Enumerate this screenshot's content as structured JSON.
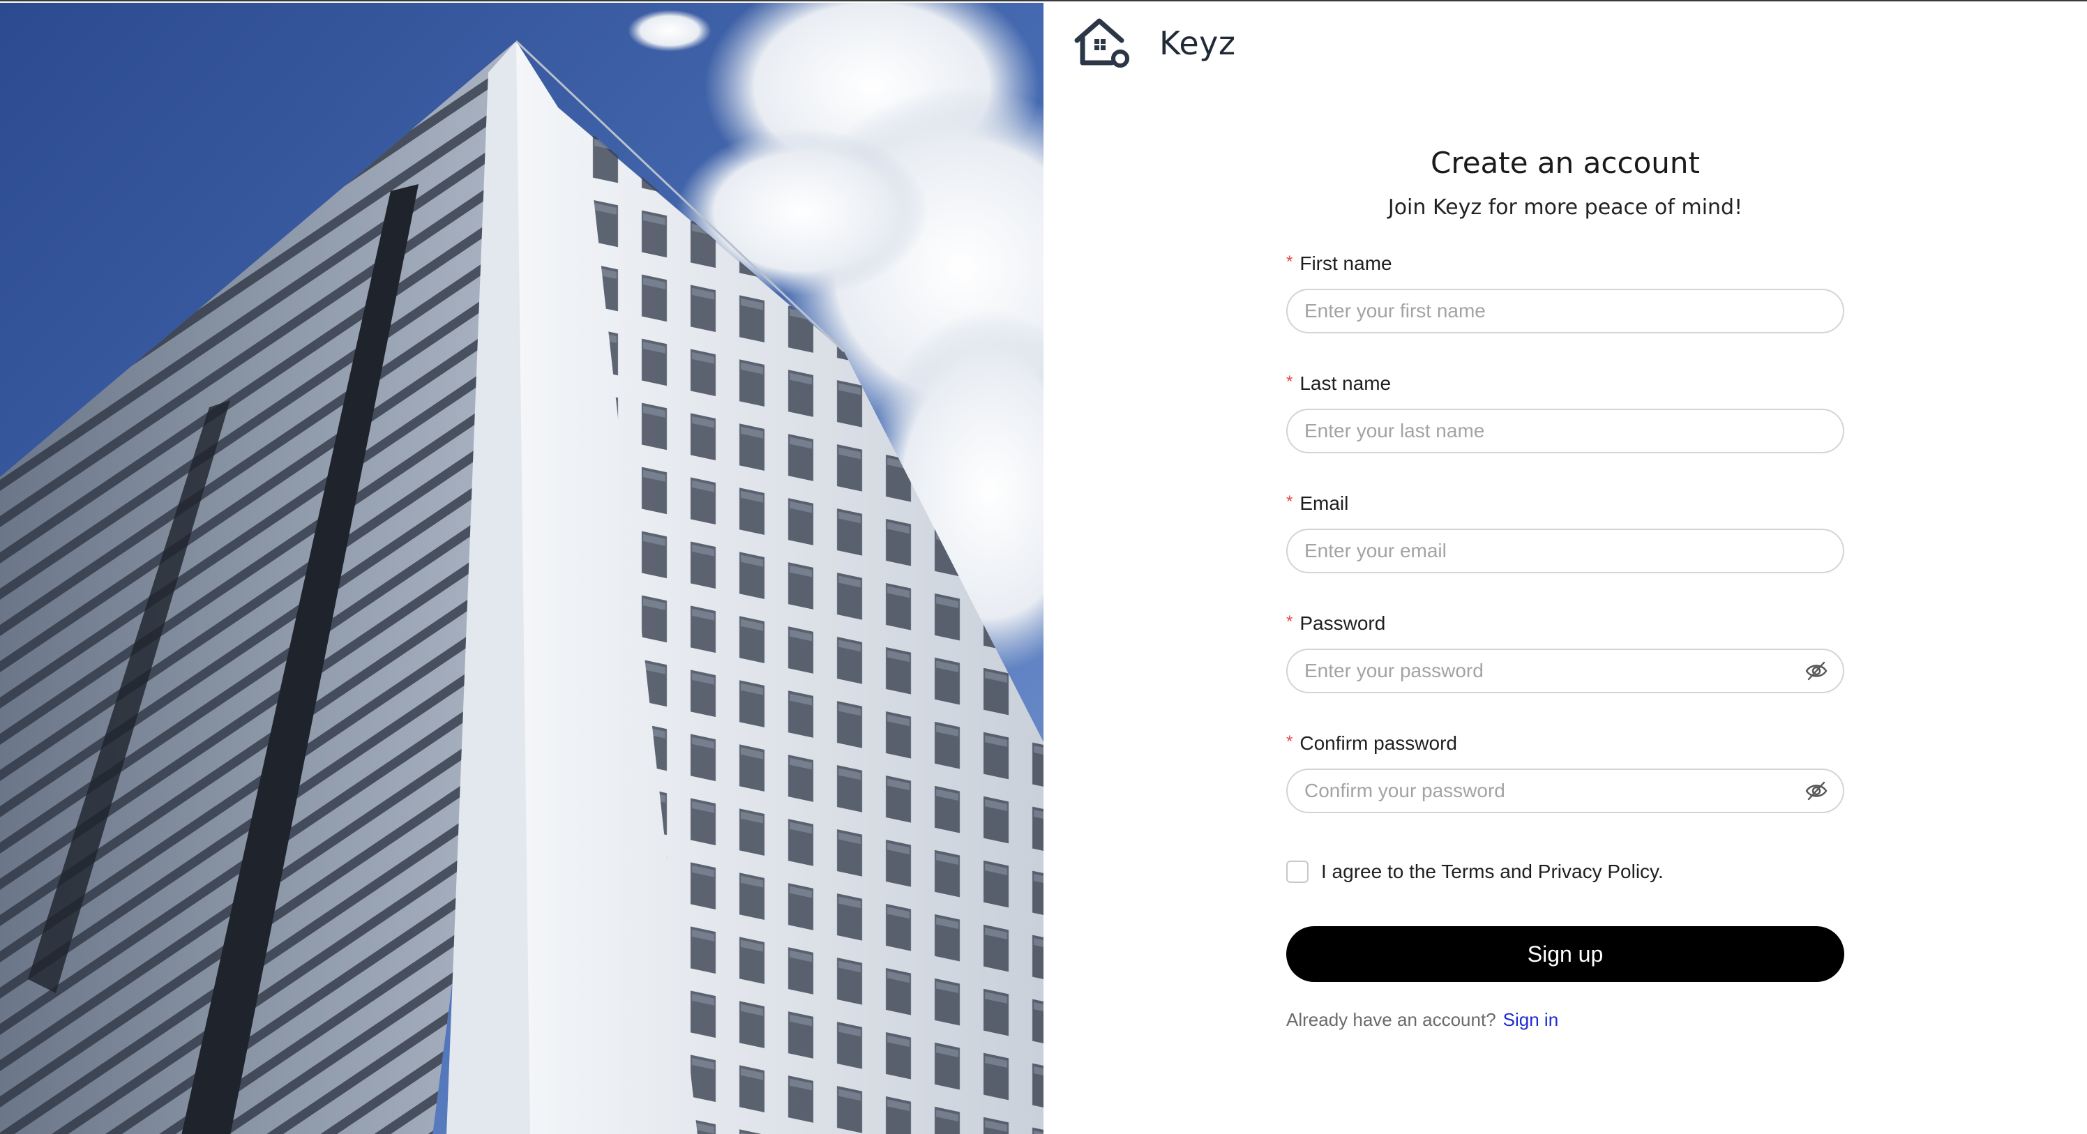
{
  "brand": {
    "name": "Keyz",
    "logo_icon": "house-key-icon"
  },
  "form": {
    "title": "Create an account",
    "subtitle": "Join Keyz for more peace of mind!",
    "required_marker": "*",
    "fields": [
      {
        "label": "First name",
        "placeholder": "Enter your first name",
        "value": ""
      },
      {
        "label": "Last name",
        "placeholder": "Enter your last name",
        "value": ""
      },
      {
        "label": "Email",
        "placeholder": "Enter your email",
        "value": ""
      },
      {
        "label": "Password",
        "placeholder": "Enter your password",
        "value": "",
        "toggle_icon": "eye-off-icon"
      },
      {
        "label": "Confirm password",
        "placeholder": "Confirm your password",
        "value": "",
        "toggle_icon": "eye-off-icon"
      }
    ],
    "agree_text": "I agree to the Terms and Privacy Policy.",
    "agree_checked": false,
    "submit_label": "Sign up",
    "already_text": "Already have an account?",
    "signin_label": "Sign in"
  },
  "colors": {
    "primary": "#000000",
    "link": "#1d2bd6",
    "required": "#e5484d",
    "sky": "#3a5aa0"
  }
}
